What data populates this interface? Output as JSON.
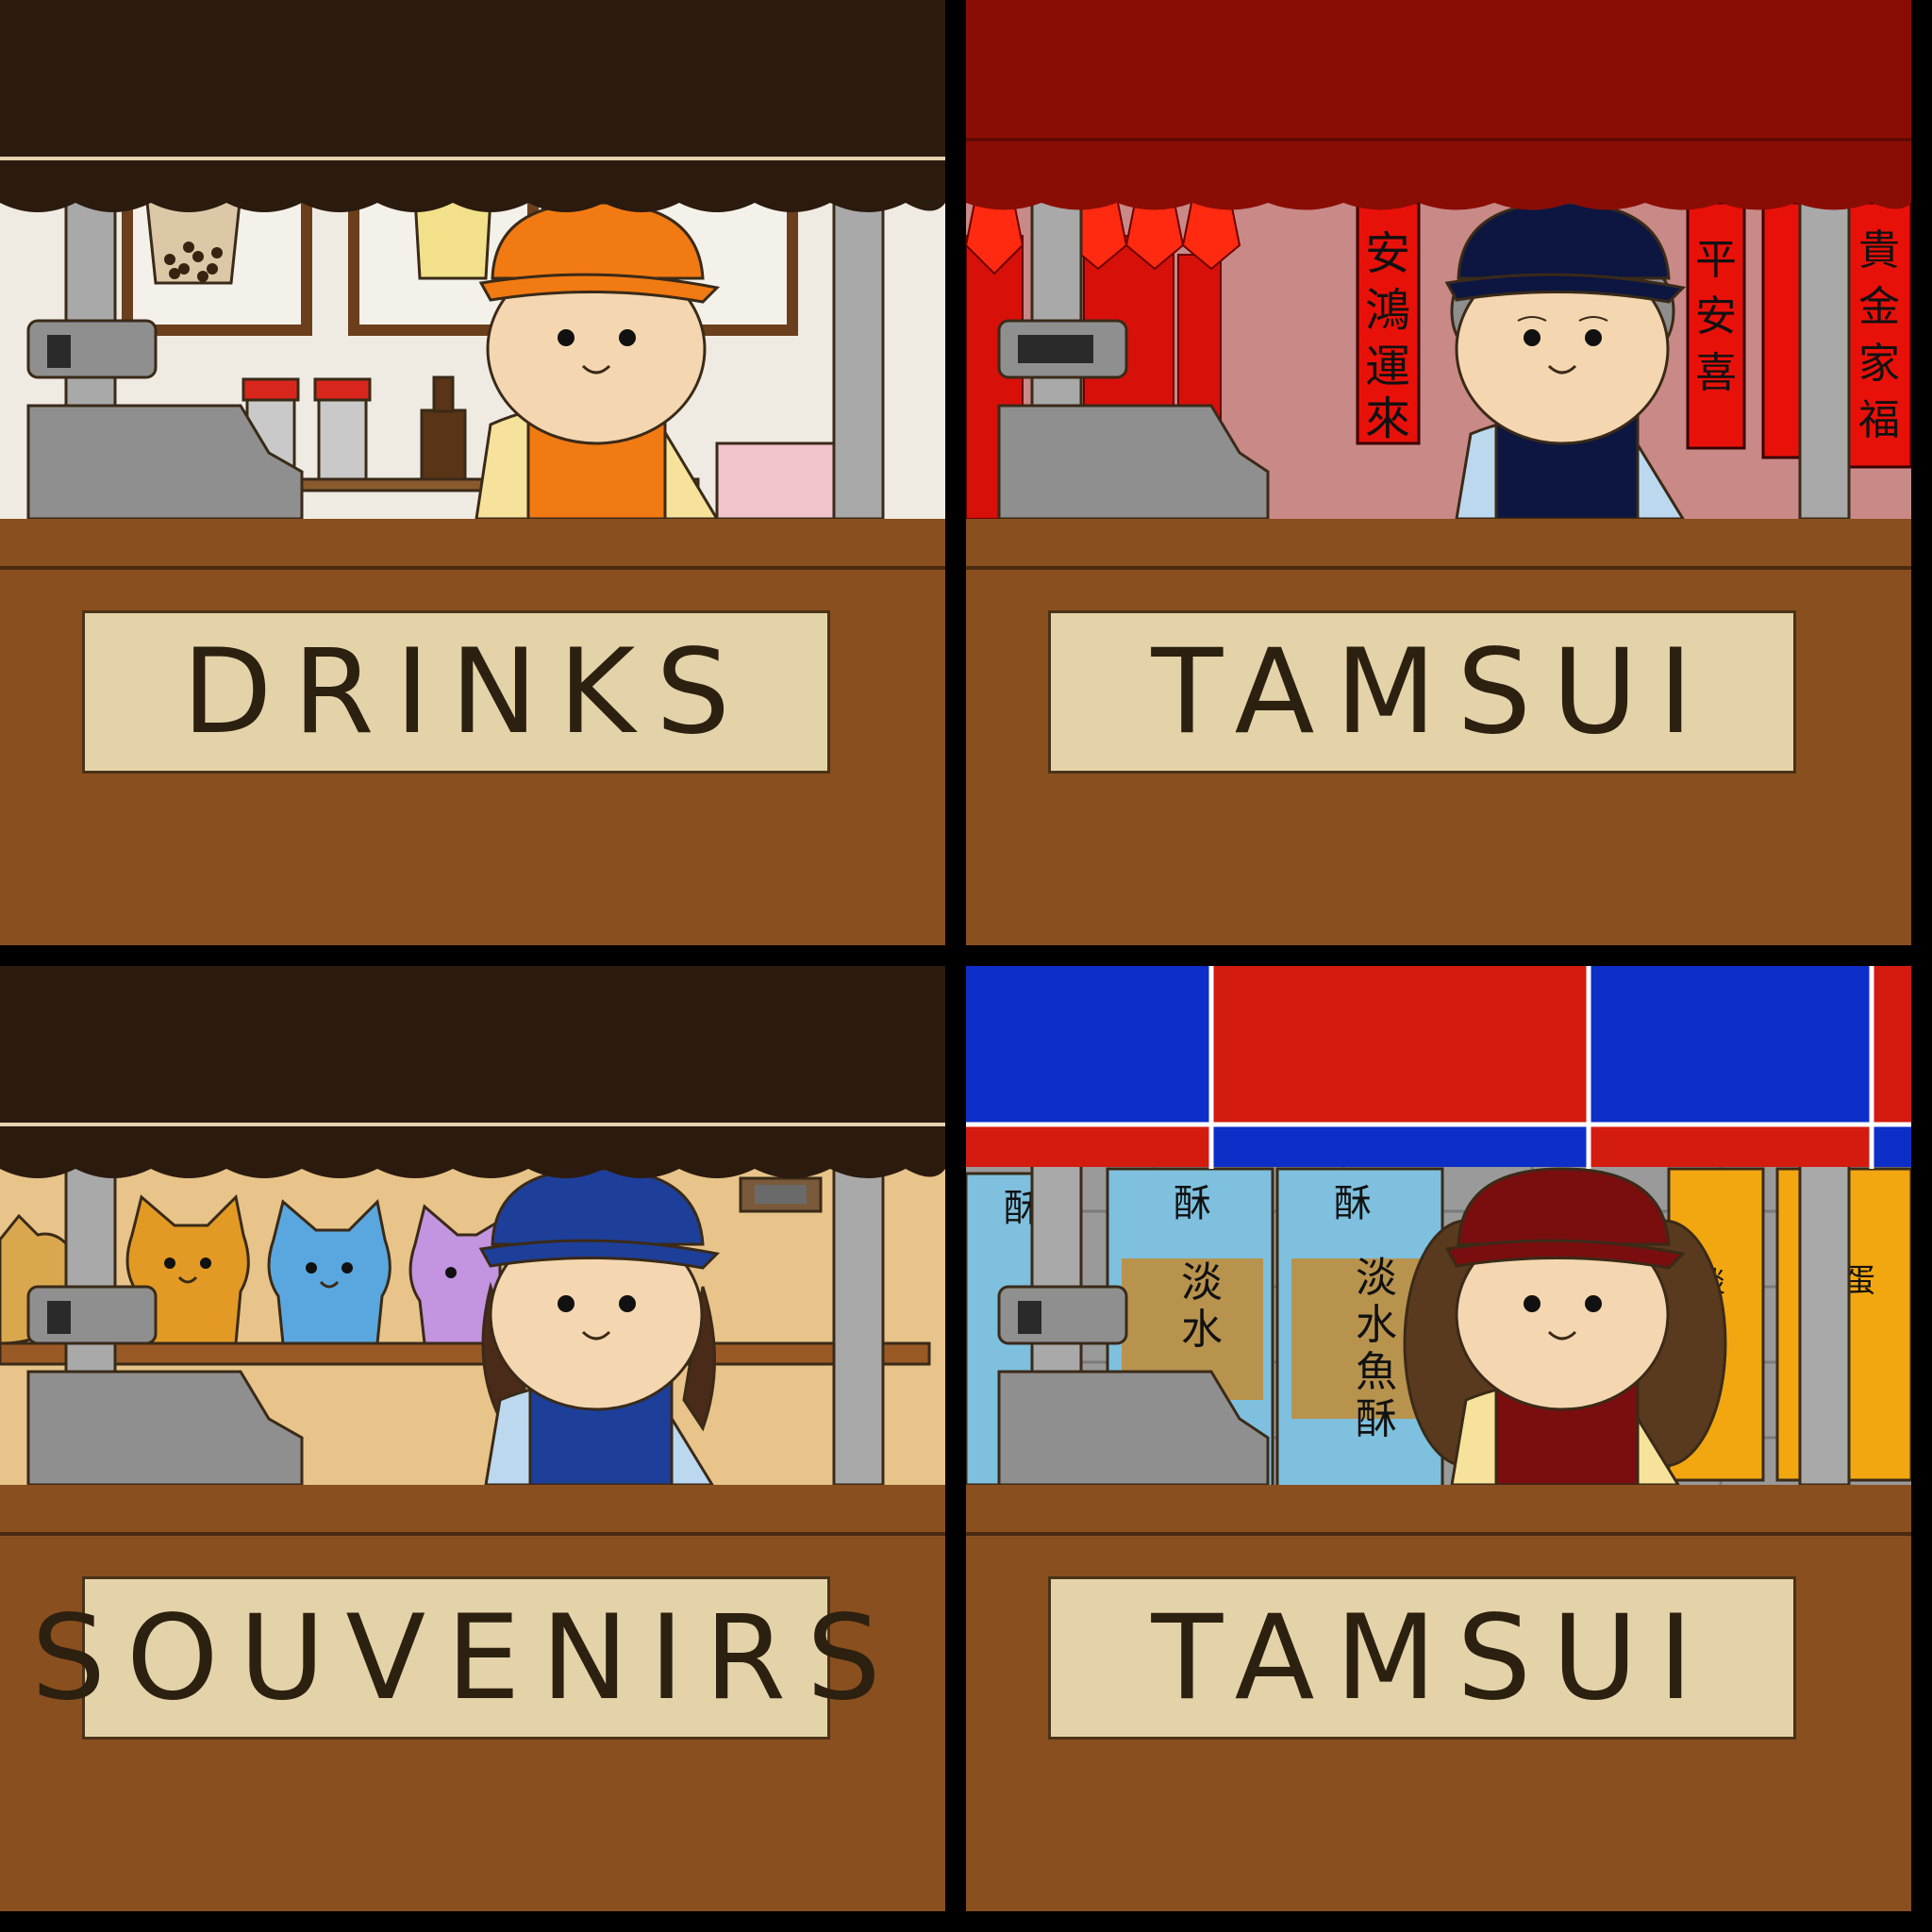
{
  "stalls": [
    {
      "sign": "DRINKS",
      "awning_color": "#2b1a0e",
      "cap_color": "#f27a12",
      "apron_color": "#f27a12",
      "backdrop": "boba-tea-menu"
    },
    {
      "sign": "TAMSUI",
      "awning_color": "#8a0d05",
      "cap_color": "#0c1640",
      "apron_color": "#0c1640",
      "backdrop": "red-couplets-and-lanterns",
      "couplet_text": [
        "安鴻運來",
        "平安喜",
        "貴金家福",
        "福"
      ]
    },
    {
      "sign": "SOUVENIRS",
      "awning_color": "#2b1a0e",
      "cap_color": "#1d3f9a",
      "apron_color": "#1d3f9a",
      "backdrop": "lucky-cat-figurines"
    },
    {
      "sign": "TAMSUI",
      "awning_color": "#d41b10",
      "awning_stripe_color": "#0d2fc7",
      "cap_color": "#7a0e0e",
      "apron_color": "#7a0e0e",
      "backdrop": "fish-cracker-snack-bags",
      "snack_text": [
        "淡水魚酥",
        "酥",
        "鐵蛋",
        "淡"
      ]
    }
  ]
}
